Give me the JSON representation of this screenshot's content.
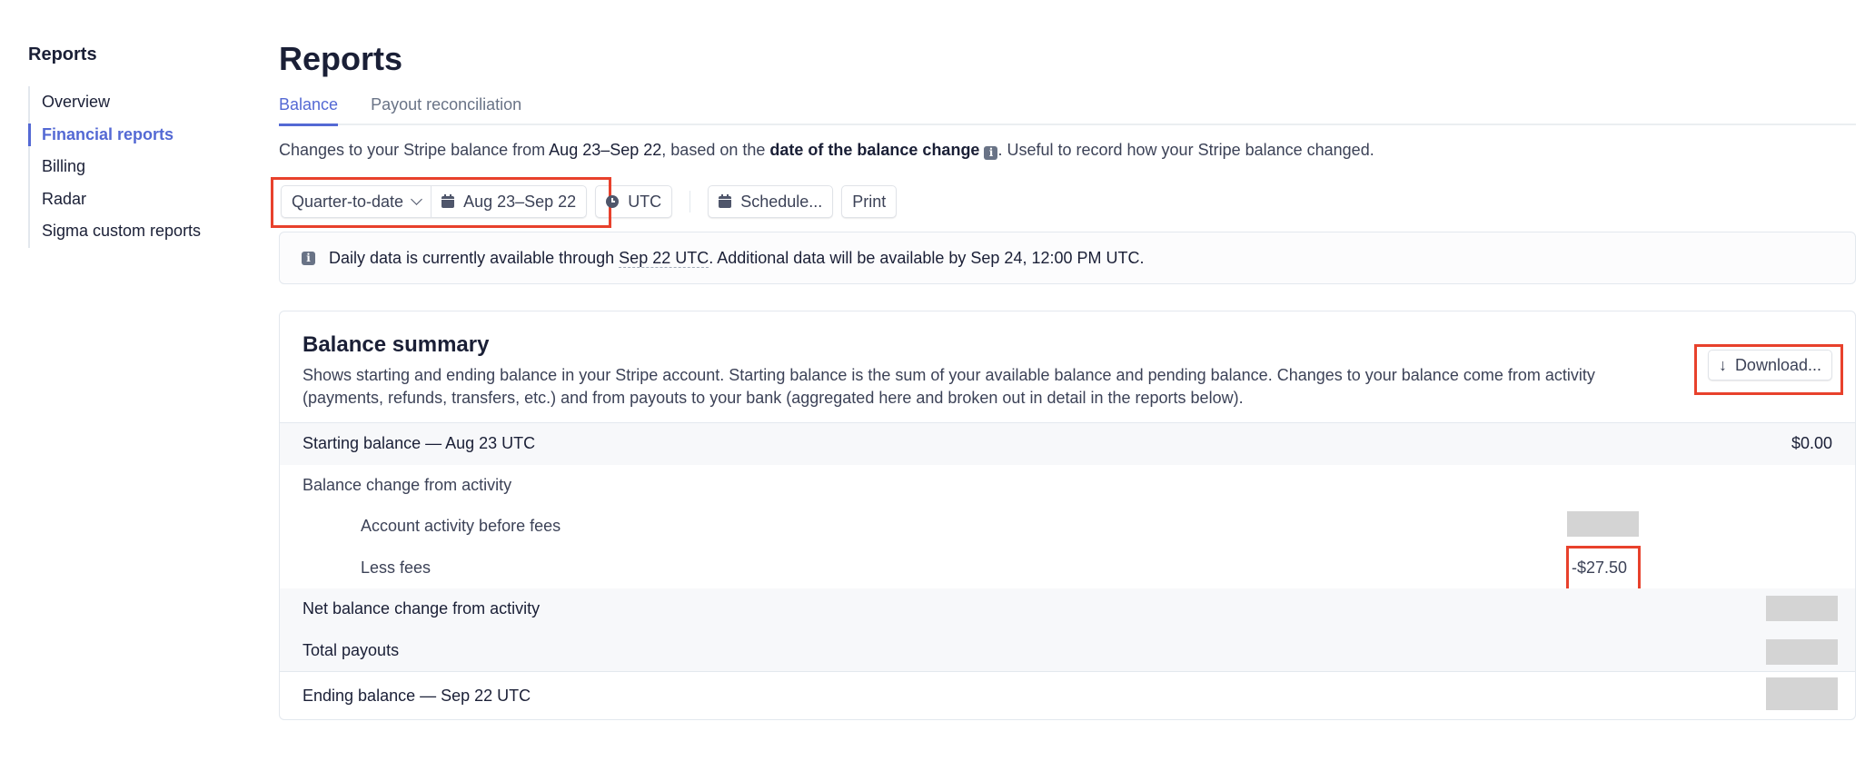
{
  "sidebar": {
    "title": "Reports",
    "items": [
      {
        "label": "Overview",
        "active": false
      },
      {
        "label": "Financial reports",
        "active": true
      },
      {
        "label": "Billing",
        "active": false
      },
      {
        "label": "Radar",
        "active": false
      },
      {
        "label": "Sigma custom reports",
        "active": false
      }
    ]
  },
  "header": {
    "title": "Reports",
    "tabs": [
      {
        "label": "Balance",
        "active": true
      },
      {
        "label": "Payout reconciliation",
        "active": false
      }
    ]
  },
  "description": {
    "prefix": "Changes to your Stripe balance from ",
    "range": "Aug 23–Sep 22",
    "middle": ", based on the ",
    "emphasis": "date of the balance change",
    "info_icon": "info-icon",
    "suffix": ". Useful to record how your Stripe balance changed."
  },
  "toolbar": {
    "period_select": "Quarter-to-date",
    "date_range": "Aug 23–Sep 22",
    "timezone": "UTC",
    "schedule_label": "Schedule...",
    "print_label": "Print",
    "icons": {
      "period": "chevron-down-icon",
      "date": "calendar-icon",
      "timezone": "clock-icon",
      "schedule": "calendar-icon"
    }
  },
  "banner": {
    "icon": "info-icon",
    "prefix": "Daily data is currently available through ",
    "date": "Sep 22 UTC",
    "suffix": ". Additional data will be available by Sep 24, 12:00 PM UTC."
  },
  "summary": {
    "title": "Balance summary",
    "description": "Shows starting and ending balance in your Stripe account. Starting balance is the sum of your available balance and pending balance. Changes to your balance come from activity (payments, refunds, transfers, etc.) and from payouts to your bank (aggregated here and broken out in detail in the reports below).",
    "download_label": "Download...",
    "download_icon": "arrow-down-icon",
    "rows": [
      {
        "label": "Starting balance — Aug 23 UTC",
        "amount": "$0.00"
      },
      {
        "label": "Balance change from activity",
        "amount": ""
      },
      {
        "label": "Account activity before fees",
        "amount": "[redacted]"
      },
      {
        "label": "Less fees",
        "amount": "-$27.50"
      },
      {
        "label": "Net balance change from activity",
        "amount": "[redacted]"
      },
      {
        "label": "Total payouts",
        "amount": "[redacted]"
      },
      {
        "label": "Ending balance — Sep 22 UTC",
        "amount": "[redacted]"
      }
    ]
  },
  "colors": {
    "accent": "#5469d4",
    "highlight": "#e8412c",
    "text": "#1a1f36",
    "muted": "#697386"
  }
}
